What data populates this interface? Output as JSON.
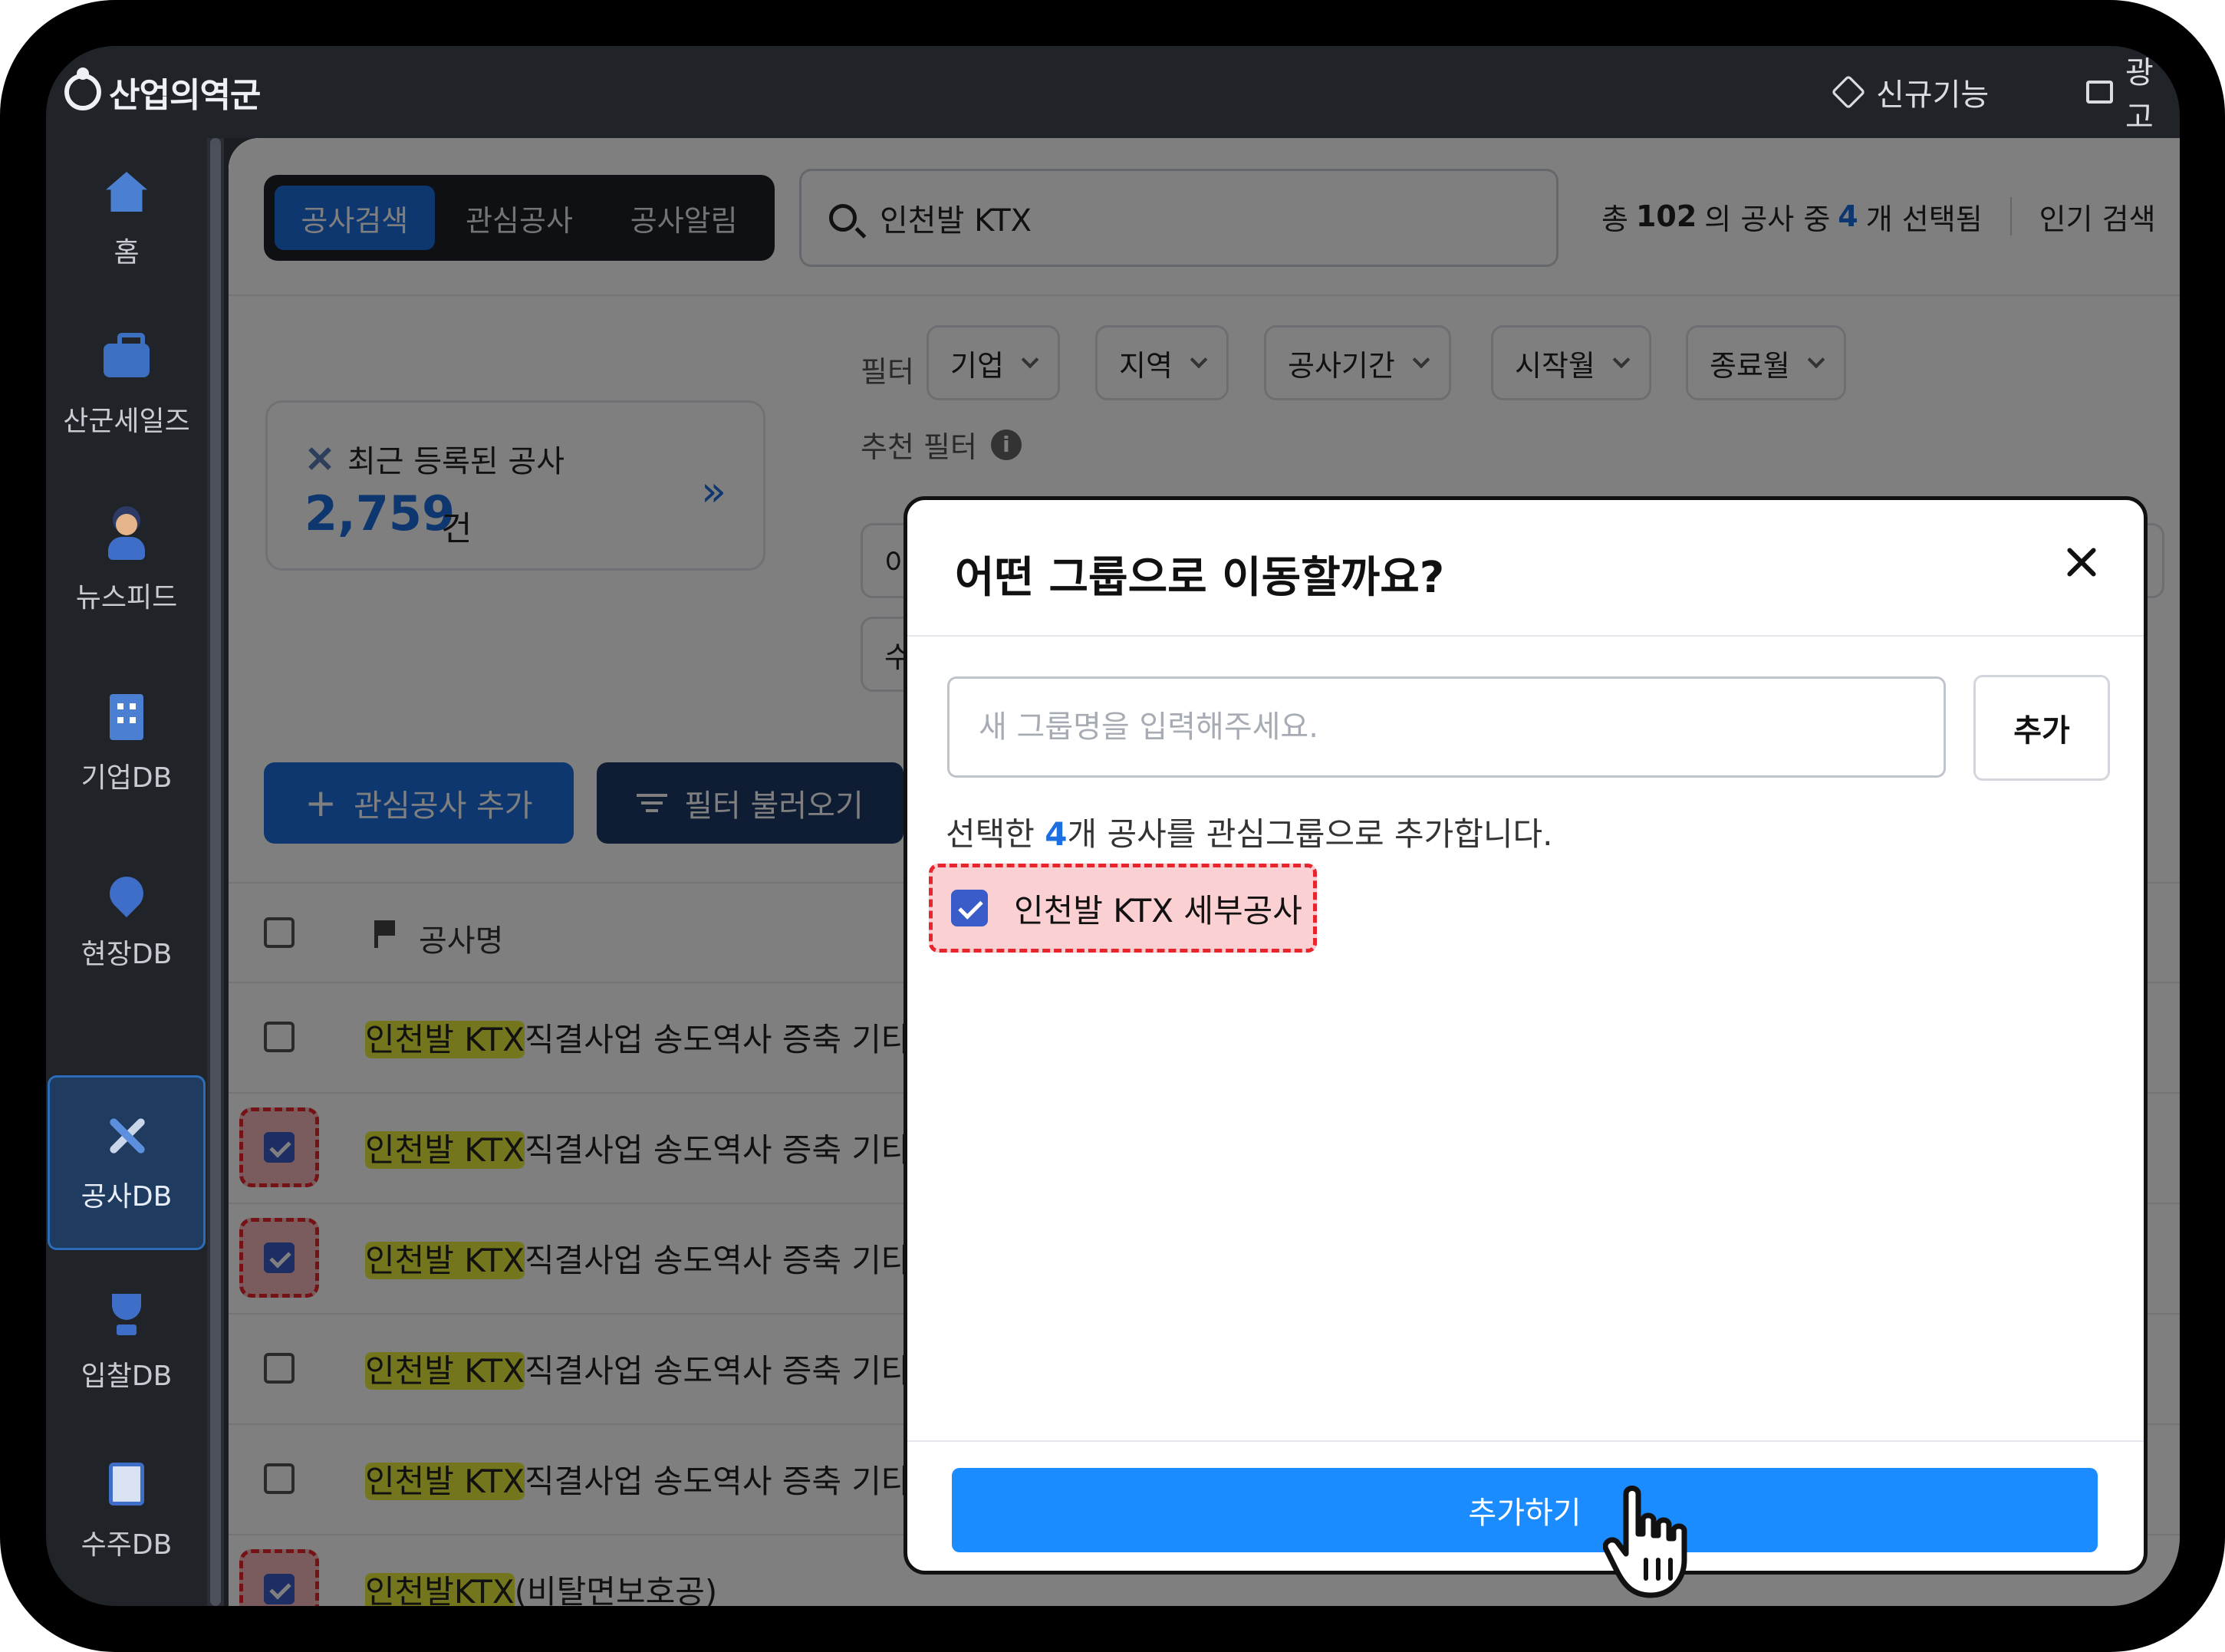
{
  "app": {
    "logo_text": "산업의역군",
    "top_new": "신규기능",
    "top_ad": "광고"
  },
  "sidebar": {
    "items": [
      {
        "label": "홈",
        "icon": "home-icon"
      },
      {
        "label": "산군세일즈",
        "icon": "briefcase-icon"
      },
      {
        "label": "뉴스피드",
        "icon": "news-icon"
      },
      {
        "label": "기업DB",
        "icon": "building-icon"
      },
      {
        "label": "현장DB",
        "icon": "map-pin-icon"
      },
      {
        "label": "공사DB",
        "icon": "tools-icon",
        "active": true
      },
      {
        "label": "입찰DB",
        "icon": "trophy-icon"
      },
      {
        "label": "수주DB",
        "icon": "document-icon"
      }
    ]
  },
  "header": {
    "tabs": [
      {
        "label": "공사검색",
        "active": true
      },
      {
        "label": "관심공사"
      },
      {
        "label": "공사알림"
      }
    ],
    "search_value": "인천발 KTX",
    "summary": {
      "prefix": "총",
      "total": "102",
      "middle": "의 공사 중",
      "selected": "4",
      "suffix": "개 선택됨"
    },
    "popular": "인기 검색"
  },
  "recent": {
    "title": "최근 등록된 공사",
    "count": "2,759",
    "unit": "건",
    "chevron": "»"
  },
  "filters": {
    "label": "필터",
    "chips": [
      "기업",
      "지역",
      "공사기간",
      "시작월",
      "종료월"
    ],
    "recommended_label": "추천 필터",
    "recommended_chips": [
      "이번",
      "수도권"
    ]
  },
  "actions": {
    "add_interest": "관심공사 추가",
    "load_filter": "필터 불러오기"
  },
  "table": {
    "header_name": "공사명",
    "rows": [
      {
        "highlight": "인천발 KTX",
        "rest": "직결사업 송도역사 증축 기타",
        "checked": false
      },
      {
        "highlight": "인천발 KTX",
        "rest": "직결사업 송도역사 증축 기타",
        "checked": true
      },
      {
        "highlight": "인천발 KTX",
        "rest": "직결사업 송도역사 증축 기타",
        "checked": true
      },
      {
        "highlight": "인천발 KTX",
        "rest": "직결사업 송도역사 증축 기타",
        "checked": false
      },
      {
        "highlight": "인천발 KTX",
        "rest": "직결사업 송도역사 증축 기타",
        "checked": false
      },
      {
        "highlight": "인천발KTX",
        "rest": "(비탈면보호공)",
        "checked": true
      }
    ]
  },
  "modal": {
    "title": "어떤 그룹으로 이동할까요?",
    "input_placeholder": "새 그룹명을 입력해주세요.",
    "add_label": "추가",
    "msg_prefix": "선택한",
    "msg_count": "4",
    "msg_suffix": "개 공사를 관심그룹으로 추가합니다.",
    "group_name": "인천발 KTX 세부공사",
    "primary_label": "추가하기"
  },
  "colors": {
    "accent": "#1c6fe0",
    "primary_button": "#1a8cff",
    "highlight": "#e9ec3a",
    "callout": "#e8242c"
  }
}
